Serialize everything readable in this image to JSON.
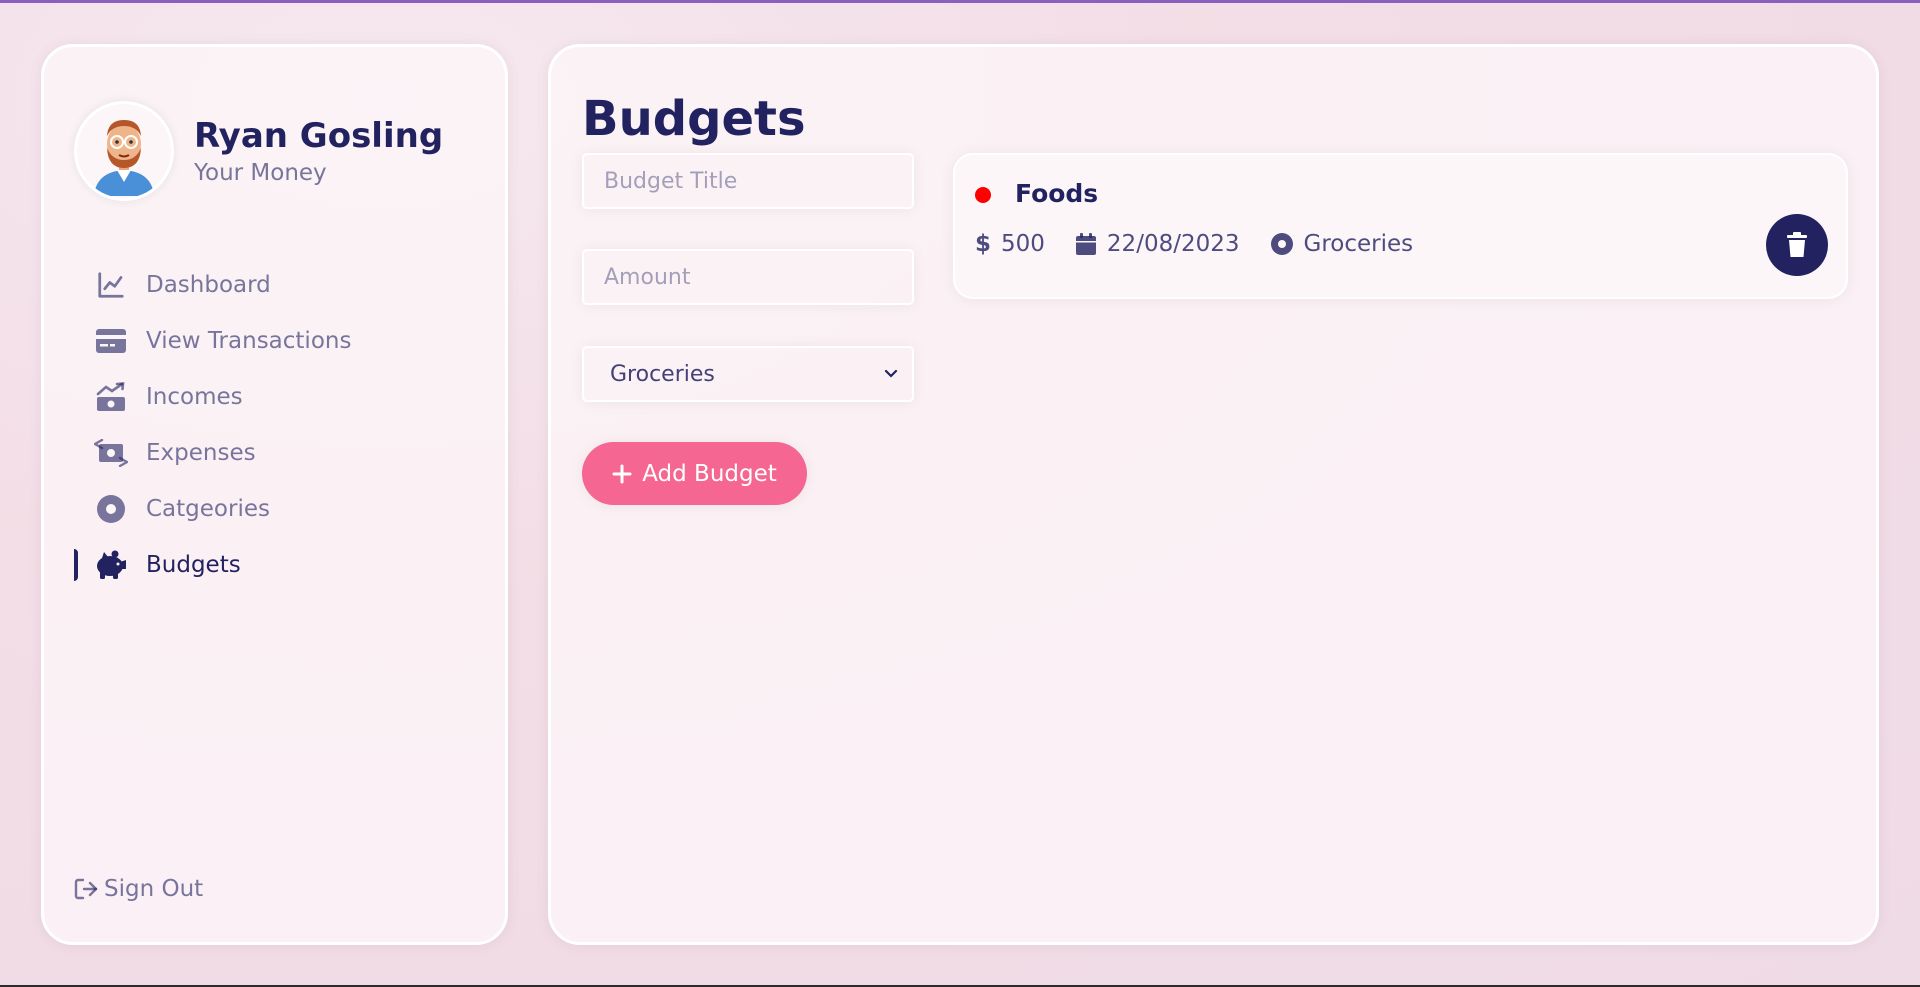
{
  "user": {
    "name": "Ryan Gosling",
    "subtitle": "Your Money"
  },
  "menu": {
    "items": [
      {
        "label": "Dashboard",
        "icon": "chart-line-icon"
      },
      {
        "label": "View Transactions",
        "icon": "credit-card-icon"
      },
      {
        "label": "Incomes",
        "icon": "money-bill-trend-up-icon"
      },
      {
        "label": "Expenses",
        "icon": "money-bill-transfer-icon"
      },
      {
        "label": "Catgeories",
        "icon": "circle-dot-icon"
      },
      {
        "label": "Budgets",
        "icon": "piggy-bank-icon",
        "active": true
      }
    ]
  },
  "signout": {
    "label": "Sign Out",
    "icon": "sign-out-icon"
  },
  "page": {
    "title": "Budgets"
  },
  "form": {
    "title_placeholder": "Budget Title",
    "amount_placeholder": "Amount",
    "category_selected": "Groceries",
    "add_button_label": "Add Budget"
  },
  "budgets": [
    {
      "title": "Foods",
      "currency_symbol": "$",
      "amount": "500",
      "date": "22/08/2023",
      "category": "Groceries",
      "dot_color": "#ff0000"
    }
  ],
  "colors": {
    "primary": "#222260",
    "accent": "#f56692",
    "top_border": "#8a5fbf"
  }
}
